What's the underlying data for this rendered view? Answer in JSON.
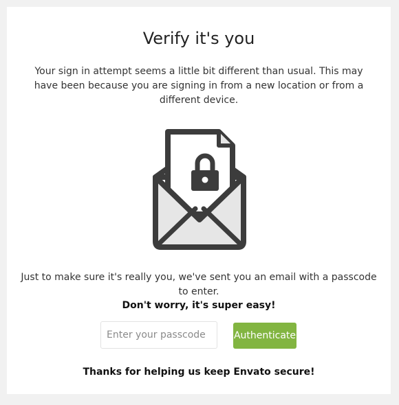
{
  "page": {
    "title": "Verify it's you",
    "intro": "Your sign in attempt seems a little bit different than usual. This may have been because you are signing in from a new location or from a different device.",
    "notice": "Just to make sure it's really you, we've sent you an email with a passcode to enter.",
    "notice_strong": "Don't worry, it's super easy!",
    "footer": "Thanks for helping us keep Envato secure!"
  },
  "form": {
    "passcode_value": "",
    "passcode_placeholder": "Enter your passcode",
    "submit_label": "Authenticate"
  },
  "illustration": {
    "icon": "envelope-with-locked-document-icon"
  },
  "colors": {
    "accent": "#82b541",
    "background": "#f1f1f1",
    "card": "#ffffff",
    "icon_dark": "#3c3c3c",
    "icon_light": "#e6e6e6"
  }
}
